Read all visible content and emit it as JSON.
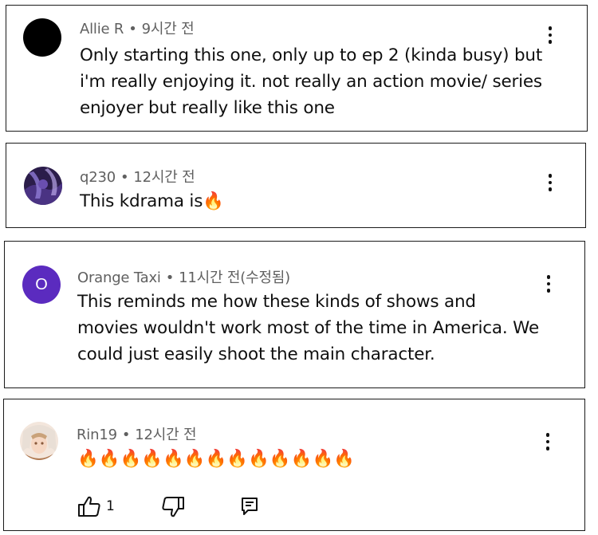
{
  "comments": [
    {
      "author": "Allie R",
      "time": "9시간 전",
      "text_lines": [
        "Only starting this one, only up to ep 2 (kinda busy) but",
        "i'm really enjoying it. not really an action movie/ series",
        "enjoyer but really like this one"
      ],
      "avatar": {
        "type": "solid",
        "color": "#000000"
      }
    },
    {
      "author": "q230",
      "time": "12시간 전",
      "text": "This kdrama is",
      "emoji": "🔥",
      "avatar": {
        "type": "image",
        "colors": [
          "#2b1d4a",
          "#6a4fb0",
          "#b9a7e8"
        ]
      }
    },
    {
      "author": "Orange Taxi",
      "time": "11시간 전(수정됨)",
      "text_lines": [
        "This reminds me how these kinds of shows and",
        "movies wouldn't work most of the time in America. We",
        "could just easily shoot the main character."
      ],
      "avatar": {
        "type": "initial",
        "letter": "O",
        "color": "#5b2bbf"
      }
    },
    {
      "author": "Rin19",
      "time": "12시간 전",
      "emoji_row": "🔥🔥🔥🔥🔥🔥🔥🔥🔥🔥🔥🔥🔥",
      "like_count": "1",
      "avatar": {
        "type": "image",
        "colors": [
          "#f3e6dc",
          "#c9a27a",
          "#8a5a3c"
        ]
      }
    }
  ],
  "separator": "•",
  "icons": {
    "more": "more-vert-icon",
    "like": "thumb-up-icon",
    "dislike": "thumb-down-icon",
    "reply": "reply-icon"
  },
  "colors": {
    "meta_text": "#606060",
    "body_text": "#0f0f0f",
    "card_border": "#1a1a1a"
  }
}
